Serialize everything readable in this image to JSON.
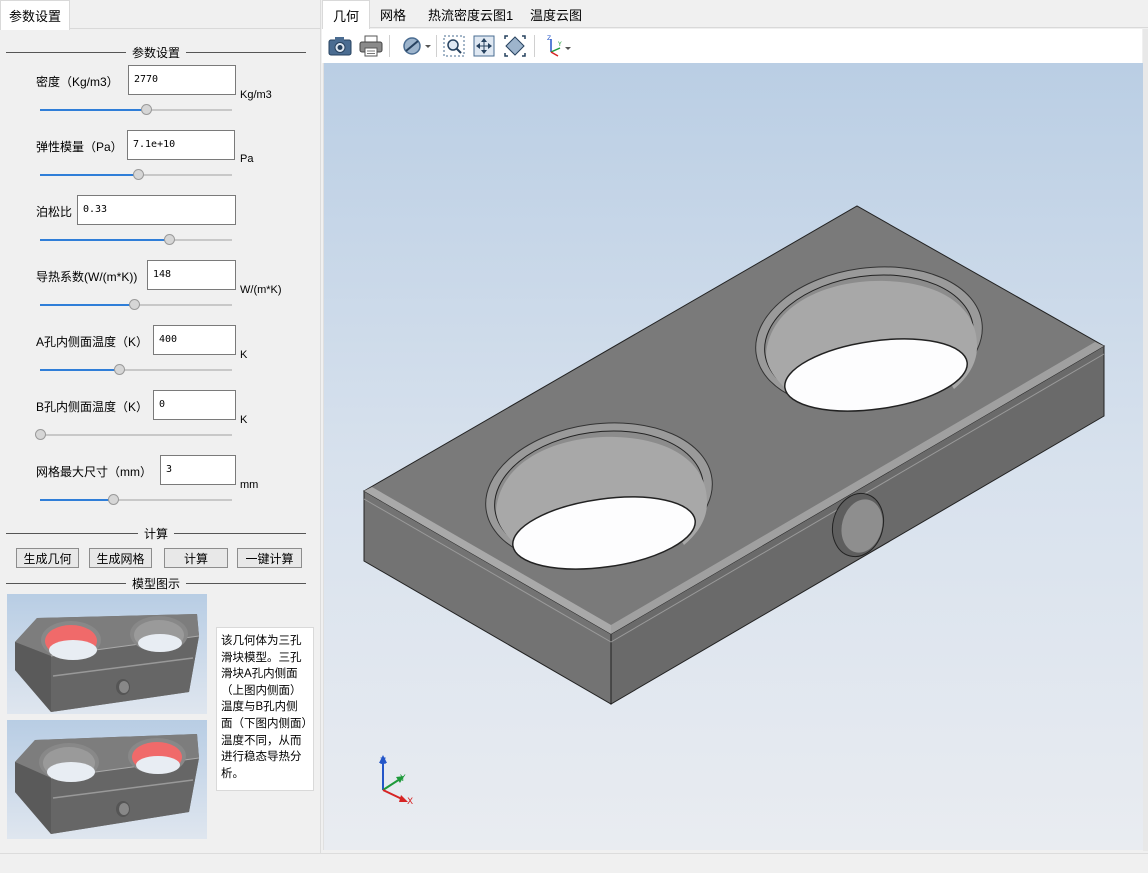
{
  "left_tab": "参数设置",
  "param_section_title": "参数设置",
  "params": [
    {
      "label": "密度（Kg/m3）",
      "value": "2770",
      "unit": "Kg/m3",
      "slider": 0.55
    },
    {
      "label": "弹性模量（Pa）",
      "value": "7.1e+10",
      "unit": "Pa",
      "slider": 0.51
    },
    {
      "label": "泊松比",
      "value": "0.33",
      "unit": "",
      "slider": 0.67
    },
    {
      "label": "导热系数(W/(m*K))",
      "value": "148",
      "unit": "W/(m*K)",
      "slider": 0.49
    },
    {
      "label": "A孔内侧面温度（K）",
      "value": "400",
      "unit": "K",
      "slider": 0.41
    },
    {
      "label": "B孔内侧面温度（K）",
      "value": "0",
      "unit": "K",
      "slider": 0.0
    },
    {
      "label": "网格最大尺寸（mm）",
      "value": "3",
      "unit": "mm",
      "slider": 0.38
    }
  ],
  "calc_section_title": "计算",
  "buttons": {
    "gen_geometry": "生成几何",
    "gen_mesh": "生成网格",
    "compute": "计算",
    "one_click": "一键计算"
  },
  "model_section_title": "模型图示",
  "description": "该几何体为三孔滑块模型。三孔滑块A孔内侧面（上图内侧面）温度与B孔内侧面（下图内侧面）温度不同，从而进行稳态导热分析。",
  "right_tabs": [
    "几何",
    "网格",
    "热流密度云图1",
    "温度云图"
  ],
  "active_tab_index": 0,
  "toolbar_icons": [
    "camera-icon",
    "print-icon",
    "view-style-icon",
    "zoom-box-icon",
    "fit-all-icon",
    "zoom-fit-icon",
    "axes-orient-icon"
  ],
  "axis_labels": {
    "x": "X",
    "y": "Y",
    "z": "Z"
  },
  "colors": {
    "slider_fill": "#2f7ed8",
    "viewport_top": "#bacee4",
    "viewport_bottom": "#e9ecf1",
    "hot_face": "#f06a6a"
  }
}
